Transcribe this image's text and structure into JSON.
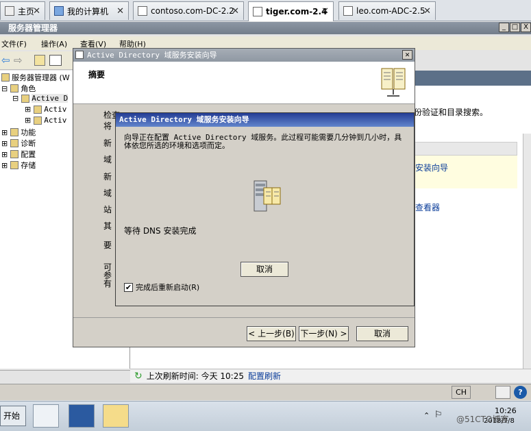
{
  "tabs": [
    {
      "label": "主页"
    },
    {
      "label": "我的计算机"
    },
    {
      "label": "contoso.com-DC-2.2"
    },
    {
      "label": "tiger.com-2.4"
    },
    {
      "label": "leo.com-ADC-2.5"
    }
  ],
  "app": {
    "title": "服务器管理器"
  },
  "window_buttons": {
    "minimize": "_",
    "restore": "□",
    "close": "X"
  },
  "menu": [
    "文件(F)",
    "操作(A)",
    "查看(V)",
    "帮助(H)"
  ],
  "tree": {
    "root": "服务器管理器 (W",
    "roles": "角色",
    "ad": "Active D",
    "ad_child1": "Activ",
    "ad_child2": "Activ",
    "features": "功能",
    "diagnostics": "诊断",
    "config": "配置",
    "storage": "存储"
  },
  "right_pane": {
    "auth_text": "份验证和目录搜索。",
    "link_wizard": "安装向导",
    "link_viewer": "查看器"
  },
  "refresh": {
    "text": "上次刷新时间: 今天 10:25",
    "link": "配置刷新"
  },
  "wizard": {
    "title": "Active Directory 域服务安装向导",
    "header": "摘要",
    "frags": [
      "检查",
      "将",
      "新",
      "域",
      "新",
      "域",
      "站",
      "其",
      "要",
      "可",
      "参",
      "有"
    ],
    "back_button": "< 上一步(B)",
    "next_button": "下一步(N) >",
    "cancel_button": "取消"
  },
  "modal": {
    "title": "Active Directory 域服务安装向导",
    "text": "向导正在配置 Active Directory 域服务。此过程可能需要几分钟到几小时，具体依您所选的环境和选项而定。",
    "status": "等待 DNS 安装完成",
    "cancel_button": "取消",
    "reboot_label": "完成后重新启动(R)",
    "reboot_checked": "✔"
  },
  "statusbar": {
    "lang": "CH"
  },
  "taskbar": {
    "start": "开始",
    "clock": "10:26",
    "date": "2018/7/8",
    "watermark": "@51CTO博客"
  }
}
